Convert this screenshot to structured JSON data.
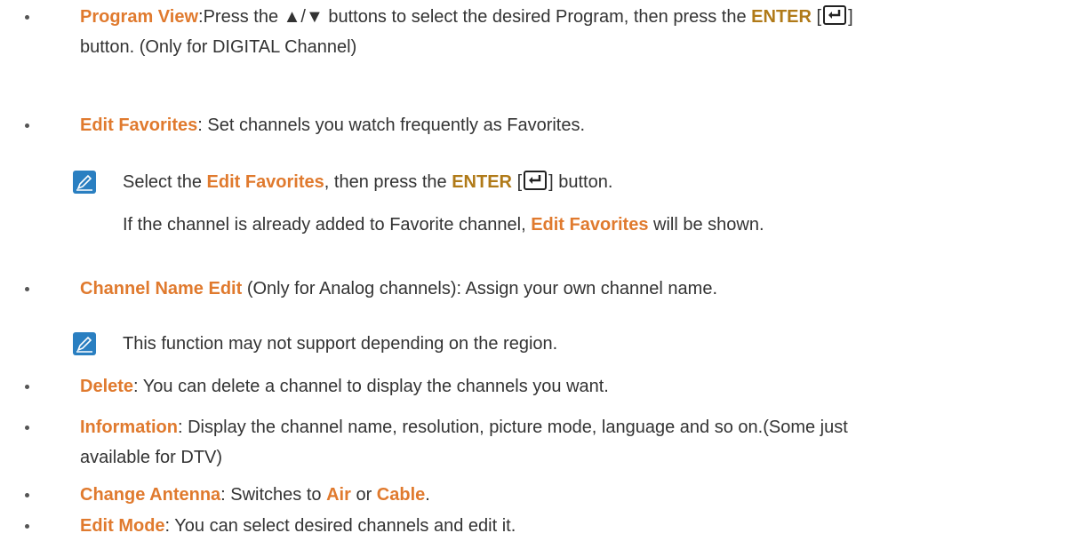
{
  "items": [
    {
      "term": "Program View",
      "before_enter": ":Press the ▲/▼ buttons to select the desired Program, then press the ",
      "enter_label": "ENTER",
      "after_enter": " button.",
      "line2": "button. (Only for DIGITAL Channel)"
    },
    {
      "term": "Edit Favorites",
      "desc": ": Set channels you watch frequently as Favorites."
    },
    {
      "term": "Channel Name Edit",
      "desc": " (Only for Analog channels): Assign your own channel name."
    },
    {
      "term": "Delete",
      "desc": ": You can delete a channel to display the channels you want."
    },
    {
      "term": "Information",
      "desc": ": Display the channel name, resolution, picture mode, language and so on.(Some just",
      "line2": "available for DTV)"
    },
    {
      "term": "Change Antenna",
      "desc_a": ": Switches to ",
      "opt1": "Air",
      "desc_b": " or ",
      "opt2": "Cable",
      "desc_c": "."
    },
    {
      "term": "Edit Mode",
      "desc": ": You can select desired channels and edit it."
    }
  ],
  "notes": {
    "favorites_1_a": "Select the ",
    "favorites_1_term": "Edit Favorites",
    "favorites_1_b": ", then press the ",
    "favorites_1_enter": "ENTER",
    "favorites_1_c": " button.",
    "favorites_2_a": "If the channel is already added to Favorite channel, ",
    "favorites_2_term": "Edit Favorites",
    "favorites_2_b": " will be shown.",
    "region": "This function may not support depending on the region."
  },
  "icons": {
    "note": "note-pencil-icon",
    "enter": "enter-key-icon"
  },
  "colors": {
    "keyword": "#e07a2e",
    "enter": "#b07a18",
    "note_icon": "#2a7fc1"
  }
}
